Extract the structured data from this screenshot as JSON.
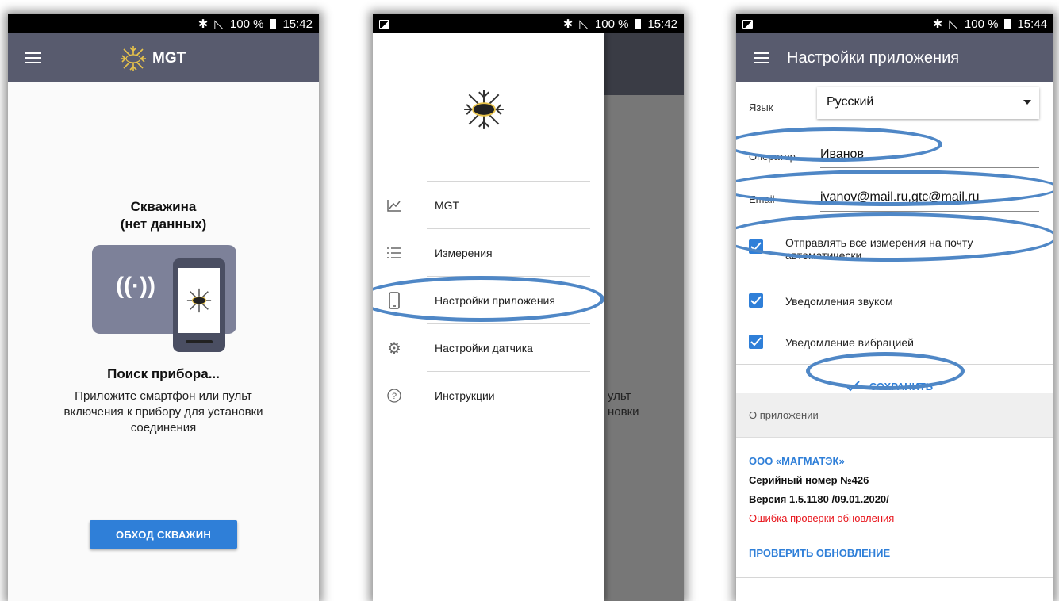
{
  "status": {
    "screen1": {
      "battery": "100 %",
      "time": "15:42"
    },
    "screen2": {
      "battery": "100 %",
      "time": "15:42"
    },
    "screen3": {
      "battery": "100 %",
      "time": "15:44"
    }
  },
  "screen1": {
    "app_title": "MGT",
    "well_title_line1": "Скважина",
    "well_title_line2": "(нет данных)",
    "searching": "Поиск прибора...",
    "hint_line1": "Приложите смартфон или пульт",
    "hint_line2": "включения к прибору для установки",
    "hint_line3": "соединения",
    "button": "ОБХОД СКВАЖИН"
  },
  "screen2": {
    "menu": [
      {
        "label": "MGT",
        "icon": "chart-line-icon"
      },
      {
        "label": "Измерения",
        "icon": "list-icon"
      },
      {
        "label": "Настройки приложения",
        "icon": "phone-icon"
      },
      {
        "label": "Настройки датчика",
        "icon": "gear-icon"
      },
      {
        "label": "Инструкции",
        "icon": "help-circle-icon"
      }
    ],
    "behind_text_line1": "ульт",
    "behind_text_line2": "новки"
  },
  "screen3": {
    "title": "Настройки приложения",
    "language_label": "Язык",
    "language_value": "Русский",
    "operator_label": "Оператор",
    "operator_value": "Иванов",
    "email_label": "Email",
    "email_value": "ivanov@mail.ru,gtc@mail.ru",
    "checkbox_auto_send_line1": "Отправлять все измерения на почту",
    "checkbox_auto_send_line2": "автоматически",
    "checkbox_sound": "Уведомления звуком",
    "checkbox_vibration": "Уведомление вибрацией",
    "save_button": "СОХРАНИТЬ",
    "about_header": "О приложении",
    "company": "ООО «МАГМАТЭК»",
    "serial": "Серийный номер №426",
    "version": "Версия 1.5.1180 /09.01.2020/",
    "update_error": "Ошибка проверки обновления",
    "check_update": "ПРОВЕРИТЬ ОБНОВЛЕНИЕ"
  },
  "colors": {
    "appbar": "#585b6e",
    "accent": "#2f7fd8",
    "highlight_ellipse": "#4f87c6",
    "error": "#e8141b",
    "link": "#2f7fd8"
  }
}
